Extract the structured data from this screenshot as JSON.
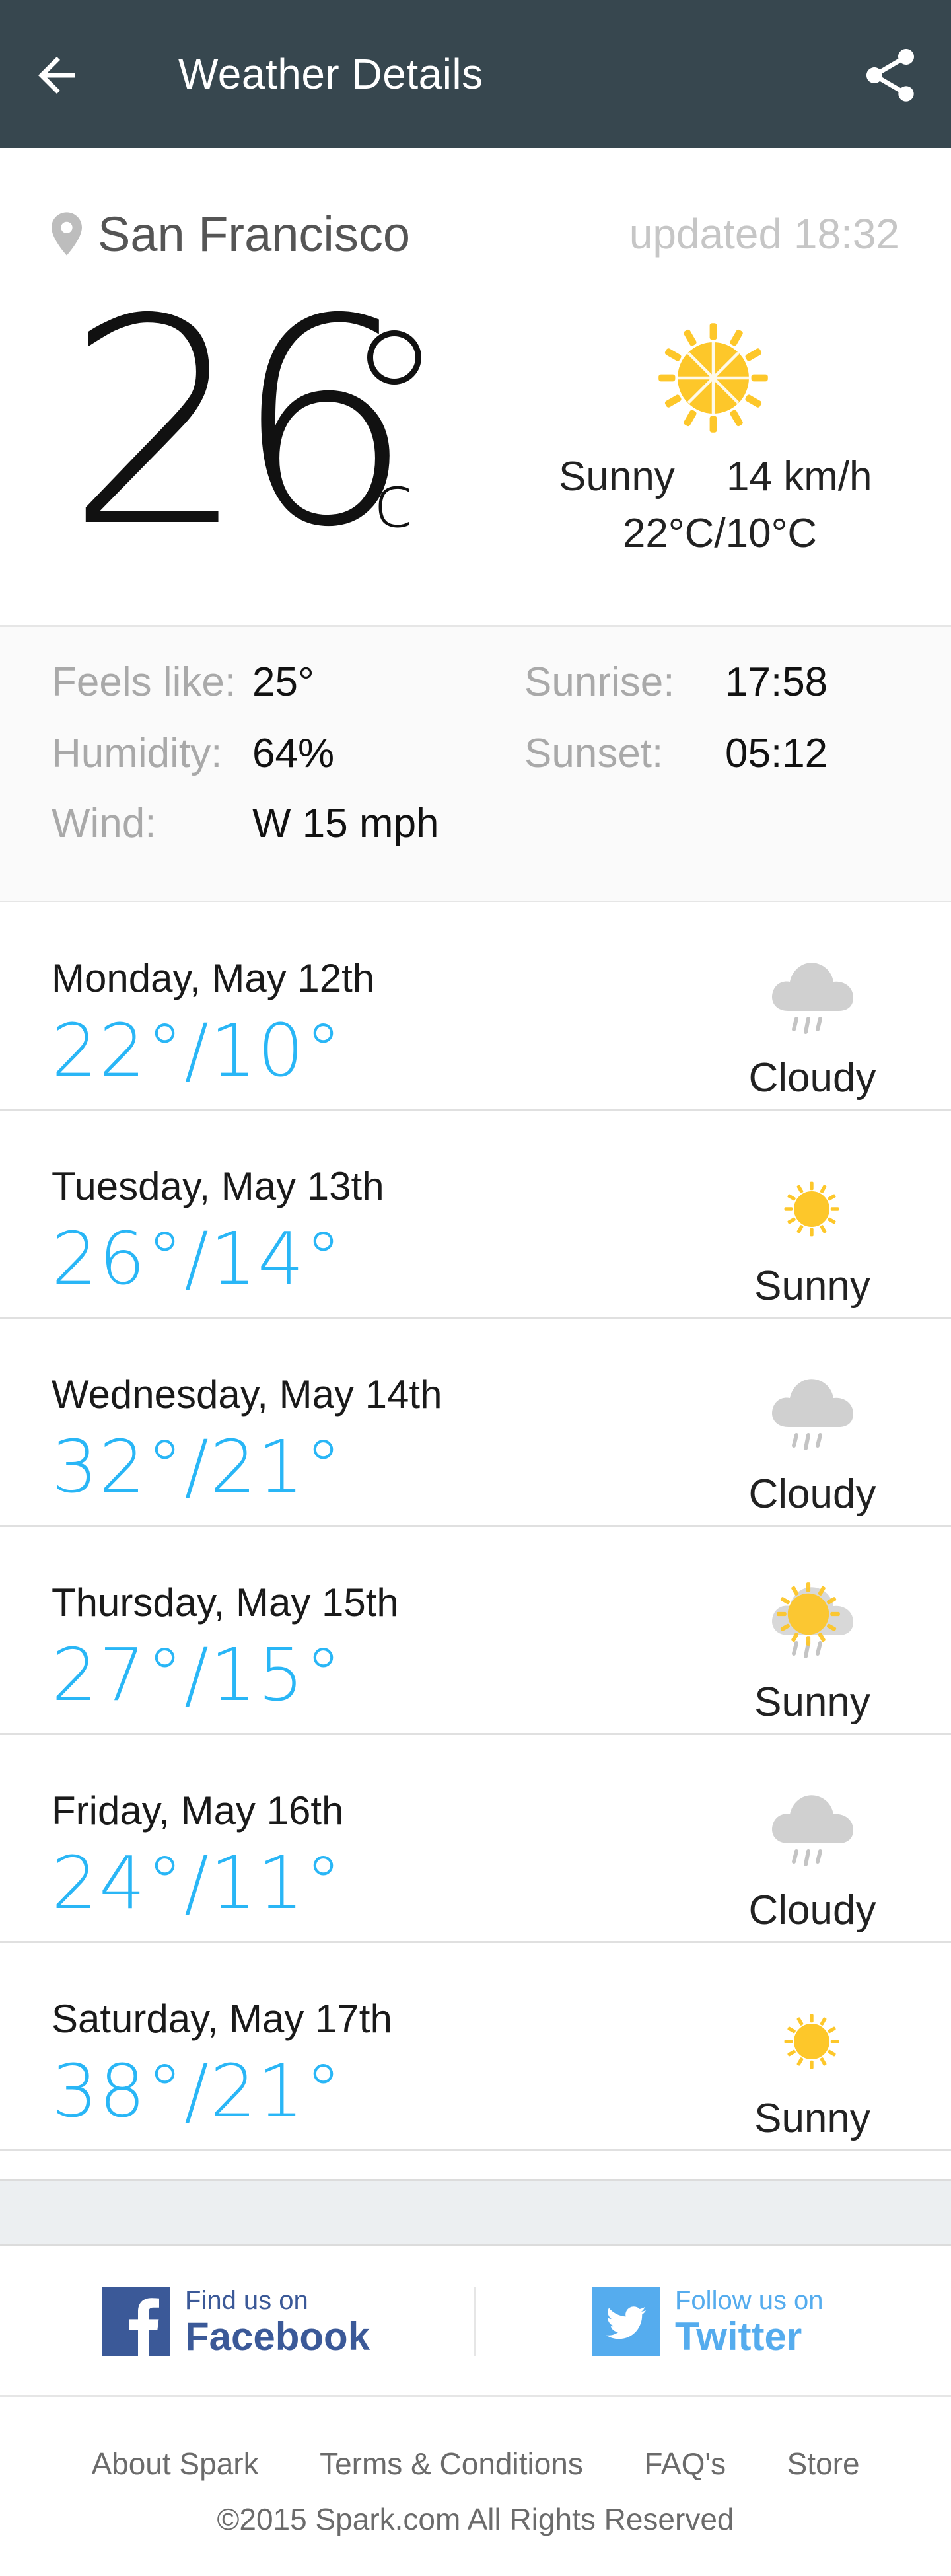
{
  "header": {
    "title": "Weather Details",
    "back_icon": "arrow-back-icon",
    "share_icon": "share-icon",
    "background": "#37474f"
  },
  "current": {
    "location": "San Francisco",
    "updated": "updated 18:32",
    "temperature": "26",
    "unit": "c",
    "condition": "Sunny",
    "wind": "14 km/h",
    "range": "22°C/10°C",
    "icon": "sun-icon"
  },
  "details": {
    "feels_like_label": "Feels like:",
    "feels_like_value": "25°",
    "humidity_label": "Humidity:",
    "humidity_value": "64%",
    "wind_label": "Wind:",
    "wind_value": "W 15 mph",
    "sunrise_label": "Sunrise:",
    "sunrise_value": "17:58",
    "sunset_label": "Sunset:",
    "sunset_value": "05:12"
  },
  "forecast": [
    {
      "day": "Monday, May 12th",
      "range": "22°/10°",
      "condition": "Cloudy",
      "icon": "cloud-rain-icon"
    },
    {
      "day": "Tuesday, May 13th",
      "range": "26°/14°",
      "condition": "Sunny",
      "icon": "sun-icon"
    },
    {
      "day": "Wednesday, May 14th",
      "range": "32°/21°",
      "condition": "Cloudy",
      "icon": "cloud-rain-icon"
    },
    {
      "day": "Thursday, May 15th",
      "range": "27°/15°",
      "condition": "Sunny",
      "icon": "sun-cloud-rain-icon"
    },
    {
      "day": "Friday, May 16th",
      "range": "24°/11°",
      "condition": "Cloudy",
      "icon": "cloud-rain-icon"
    },
    {
      "day": "Saturday, May 17th",
      "range": "38°/21°",
      "condition": "Sunny",
      "icon": "sun-icon"
    }
  ],
  "social": {
    "facebook_small": "Find us on",
    "facebook_big": "Facebook",
    "facebook_color": "#3b5998",
    "twitter_small": "Follow us on",
    "twitter_big": "Twitter",
    "twitter_color": "#55acee"
  },
  "footer": {
    "links": [
      "About Spark",
      "Terms & Conditions",
      "FAQ's",
      "Store"
    ],
    "copyright": "©2015 Spark.com All Rights Reserved"
  },
  "colors": {
    "accent_blue": "#29b6f6",
    "sun_yellow": "#fdc72a",
    "cloud_gray": "#d0d0d0"
  }
}
